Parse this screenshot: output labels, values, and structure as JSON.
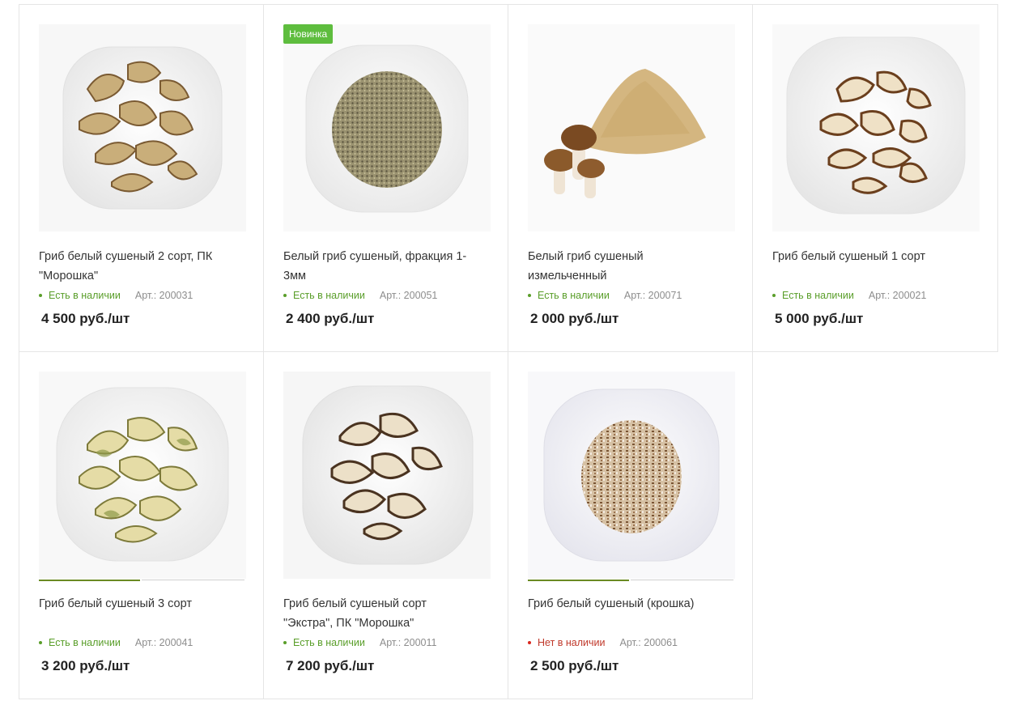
{
  "colors": {
    "badge_bg": "#5ebd3e",
    "in_stock": "#5a9e2a",
    "out_of_stock": "#d9271e",
    "slider_active": "#6a8a22"
  },
  "products": [
    {
      "title": "Гриб белый сушеный 2 сорт, ПК \"Морошка\"",
      "stock": "Есть в наличии",
      "article": "Арт.: 200031",
      "price": "4 500 руб./шт",
      "image": "dried-mushroom-slices-plate-icon"
    },
    {
      "badge": "Новинка",
      "title": "Белый гриб сушеный, фракция 1-3мм",
      "stock": "Есть в наличии",
      "article": "Арт.: 200051",
      "price": "2 400 руб./шт",
      "image": "mushroom-granules-plate-icon"
    },
    {
      "title": "Белый гриб сушеный измельченный",
      "stock": "Есть в наличии",
      "article": "Арт.: 200071",
      "price": "2 000 руб./шт",
      "image": "mushroom-powder-with-mushrooms-icon"
    },
    {
      "title": "Гриб белый сушеный 1 сорт",
      "stock": "Есть в наличии",
      "article": "Арт.: 200021",
      "price": "5 000 руб./шт",
      "image": "dried-mushroom-slices-plate-icon"
    },
    {
      "title": "Гриб белый сушеный 3 сорт",
      "stock": "Есть в наличии",
      "article": "Арт.: 200041",
      "price": "3 200 руб./шт",
      "image": "dried-mushroom-slices-plate-icon"
    },
    {
      "title": "Гриб белый сушеный сорт \"Экстра\", ПК \"Морошка\"",
      "stock": "Есть в наличии",
      "article": "Арт.: 200011",
      "price": "7 200 руб./шт",
      "image": "dried-mushroom-slices-plate-icon"
    },
    {
      "title": "Гриб белый сушеный (крошка)",
      "stock": "Нет в наличии",
      "article": "Арт.: 200061",
      "price": "2 500 руб./шт",
      "image": "mushroom-crumbs-plate-icon"
    }
  ]
}
